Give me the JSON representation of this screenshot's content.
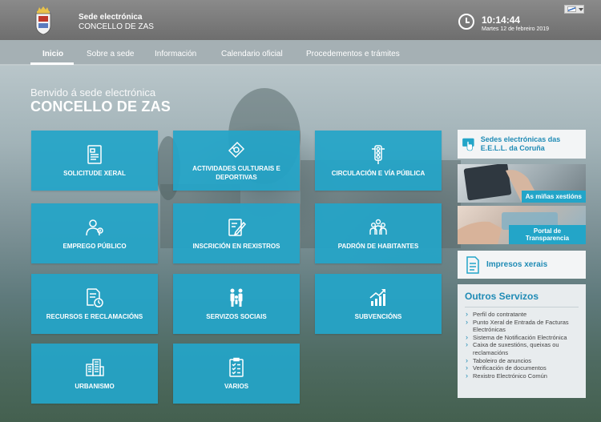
{
  "header": {
    "brand_line1": "Sede electrónica",
    "brand_line2": "CONCELLO DE ZAS",
    "time": "10:14:44",
    "date": "Martes 12 de febreiro 2019"
  },
  "nav": {
    "items": [
      {
        "label": "Inicio"
      },
      {
        "label": "Sobre a sede"
      },
      {
        "label": "Información"
      },
      {
        "label": "Calendario oficial"
      },
      {
        "label": "Procedementos e trámites"
      }
    ]
  },
  "welcome": {
    "line1": "Benvido á sede electrónica",
    "line2": "CONCELLO DE ZAS"
  },
  "tiles": [
    {
      "label": "SOLICITUDE XERAL",
      "icon": "form-icon"
    },
    {
      "label": "ACTIVIDADES CULTURAIS E DEPORTIVAS",
      "icon": "ticket-icon"
    },
    {
      "label": "CIRCULACIÓN E VÍA PÚBLICA",
      "icon": "traffic-light-icon"
    },
    {
      "label": "EMPREGO PÚBLICO",
      "icon": "worker-icon"
    },
    {
      "label": "INSCRICIÓN EN REXISTROS",
      "icon": "edit-document-icon"
    },
    {
      "label": "PADRÓN DE HABITANTES",
      "icon": "people-icon"
    },
    {
      "label": "RECURSOS E RECLAMACIÓNS",
      "icon": "document-clock-icon"
    },
    {
      "label": "SERVIZOS SOCIAIS",
      "icon": "family-icon"
    },
    {
      "label": "SUBVENCIÓNS",
      "icon": "growth-chart-icon"
    },
    {
      "label": "URBANISMO",
      "icon": "buildings-icon"
    },
    {
      "label": "VARIOS",
      "icon": "checklist-icon"
    }
  ],
  "sidebar": {
    "sedes_label": "Sedes electrónicas das E.E.L.L. da Coruña",
    "xestions_label": "As miñas xestións",
    "transparencia_label": "Portal de Transparencia",
    "impresos_label": "Impresos xerais",
    "outros_title": "Outros Servizos",
    "outros_items": [
      "Perfil do contratante",
      "Punto Xeral de Entrada de Facturas Electrónicas",
      "Sistema de Notificación Electrónica",
      "Caixa de suxestións, queixas ou reclamacións",
      "Taboleiro de anuncios",
      "Verificación de documentos",
      "Rexistro Electrónico Común"
    ]
  },
  "colors": {
    "tile": "#23a5c8",
    "accent_text": "#1f8bb5",
    "header": "#7a7a7a"
  }
}
